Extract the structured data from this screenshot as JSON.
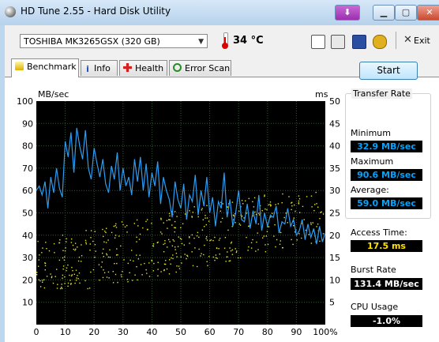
{
  "window": {
    "title": "HD Tune 2.55 - Hard Disk Utility"
  },
  "toolbar": {
    "drive": "TOSHIBA MK3265GSX (320 GB)",
    "temperature": "34 °C",
    "exit_label": "Exit"
  },
  "tabs": [
    {
      "label": "Benchmark",
      "active": true
    },
    {
      "label": "Info"
    },
    {
      "label": "Health"
    },
    {
      "label": "Error Scan"
    }
  ],
  "controls": {
    "start_label": "Start"
  },
  "transfer_rate": {
    "title": "Transfer Rate",
    "minimum_label": "Minimum",
    "minimum": "32.9 MB/sec",
    "maximum_label": "Maximum",
    "maximum": "90.6 MB/sec",
    "average_label": "Average:",
    "average": "59.0 MB/sec"
  },
  "access_time": {
    "label": "Access Time:",
    "value": "17.5 ms"
  },
  "burst_rate": {
    "label": "Burst Rate",
    "value": "131.4 MB/sec"
  },
  "cpu_usage": {
    "label": "CPU Usage",
    "value": "-1.0%"
  },
  "icons": [
    "app-icon",
    "menu-icon",
    "minimize-icon",
    "maximize-icon",
    "close-icon",
    "thermometer-icon",
    "copy-text-icon",
    "copy-image-icon",
    "save-icon",
    "options-icon",
    "exit-icon",
    "benchmark-icon",
    "info-icon",
    "health-icon",
    "error-scan-icon"
  ],
  "colors": {
    "transfer_line": "#2a9df4",
    "access_points": "#e6e62a",
    "chart_bg": "#000000",
    "grid": "#2e5a2e"
  },
  "chart_data": {
    "type": "line",
    "y_left_label": "MB/sec",
    "y_right_label": "ms",
    "y_left_ticks": [
      "100",
      "90",
      "80",
      "70",
      "60",
      "50",
      "40",
      "30",
      "20",
      "10"
    ],
    "y_right_ticks": [
      "50",
      "45",
      "40",
      "35",
      "30",
      "25",
      "20",
      "15",
      "10",
      "5"
    ],
    "x_ticks": [
      "0",
      "10",
      "20",
      "30",
      "40",
      "50",
      "60",
      "70",
      "80",
      "90",
      "100%"
    ],
    "ylim_left": [
      0,
      100
    ],
    "ylim_right": [
      0,
      50
    ],
    "xlim": [
      0,
      100
    ],
    "grid": true,
    "series": [
      {
        "axis": "left",
        "x": [
          0,
          1,
          2,
          3,
          4,
          5,
          6,
          7,
          8,
          9,
          10,
          11,
          12,
          13,
          14,
          15,
          16,
          17,
          18,
          19,
          20,
          21,
          22,
          23,
          24,
          25,
          26,
          27,
          28,
          29,
          30,
          31,
          32,
          33,
          34,
          35,
          36,
          37,
          38,
          39,
          40,
          41,
          42,
          43,
          44,
          45,
          46,
          47,
          48,
          49,
          50,
          51,
          52,
          53,
          54,
          55,
          56,
          57,
          58,
          59,
          60,
          61,
          62,
          63,
          64,
          65,
          66,
          67,
          68,
          69,
          70,
          71,
          72,
          73,
          74,
          75,
          76,
          77,
          78,
          79,
          80,
          81,
          82,
          83,
          84,
          85,
          86,
          87,
          88,
          89,
          90,
          91,
          92,
          93,
          94,
          95,
          96,
          97,
          98,
          99,
          100
        ],
        "y": [
          60,
          62,
          58,
          64,
          52,
          66,
          59,
          70,
          61,
          57,
          82,
          75,
          86,
          68,
          88,
          80,
          74,
          87,
          70,
          65,
          79,
          72,
          66,
          74,
          63,
          59,
          71,
          65,
          77,
          60,
          70,
          62,
          66,
          58,
          74,
          64,
          75,
          60,
          72,
          57,
          68,
          62,
          73,
          54,
          66,
          60,
          56,
          48,
          64,
          56,
          52,
          63,
          47,
          58,
          55,
          67,
          49,
          60,
          53,
          66,
          50,
          57,
          44,
          55,
          52,
          68,
          48,
          56,
          44,
          50,
          60,
          47,
          46,
          54,
          43,
          51,
          45,
          58,
          42,
          50,
          44,
          49,
          48,
          53,
          41,
          46,
          45,
          52,
          44,
          47,
          40,
          42,
          47,
          38,
          45,
          39,
          43,
          36,
          44,
          37,
          41
        ]
      }
    ],
    "access_points_range": {
      "x": [
        0,
        100
      ],
      "y_ms": [
        8,
        30
      ]
    }
  }
}
